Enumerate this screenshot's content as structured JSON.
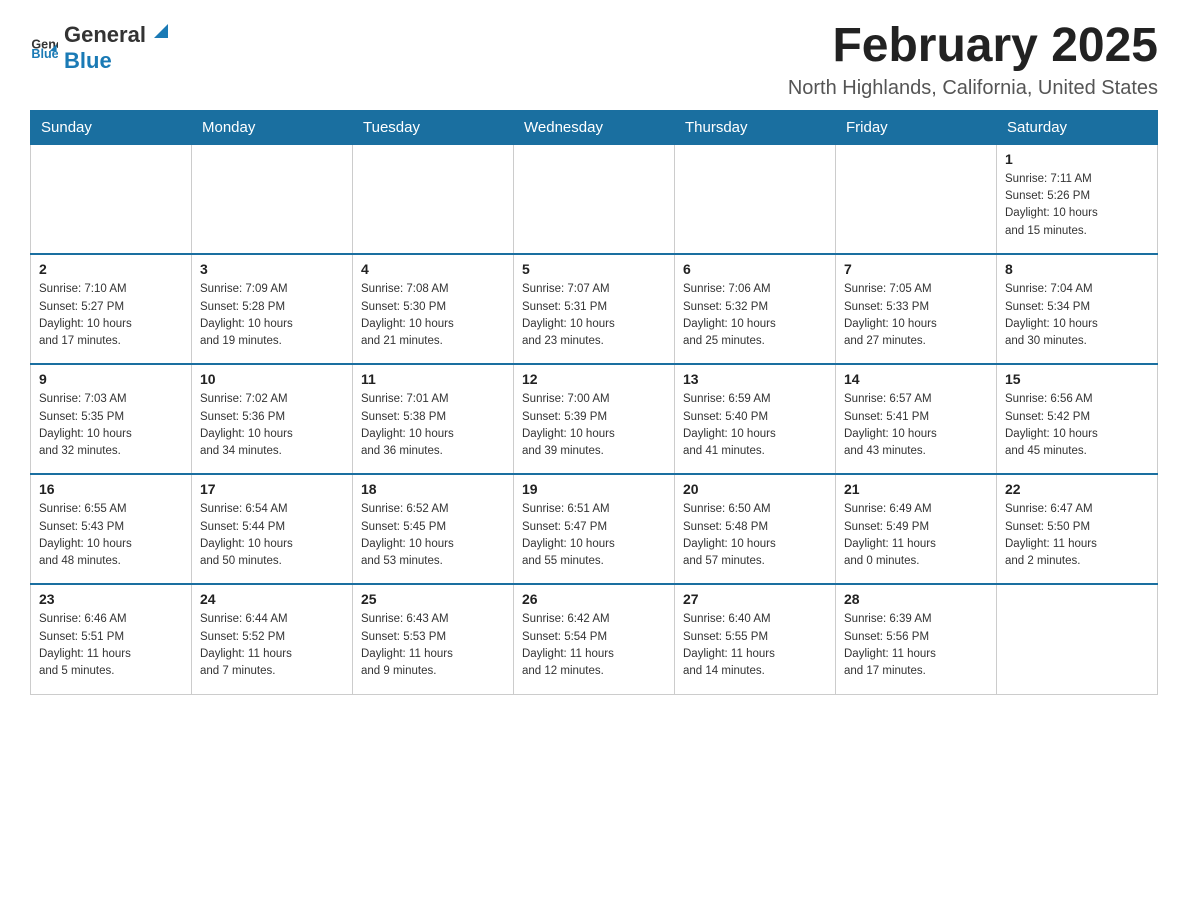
{
  "logo": {
    "text_general": "General",
    "text_blue": "Blue"
  },
  "title": "February 2025",
  "subtitle": "North Highlands, California, United States",
  "days_of_week": [
    "Sunday",
    "Monday",
    "Tuesday",
    "Wednesday",
    "Thursday",
    "Friday",
    "Saturday"
  ],
  "weeks": [
    [
      {
        "day": "",
        "info": ""
      },
      {
        "day": "",
        "info": ""
      },
      {
        "day": "",
        "info": ""
      },
      {
        "day": "",
        "info": ""
      },
      {
        "day": "",
        "info": ""
      },
      {
        "day": "",
        "info": ""
      },
      {
        "day": "1",
        "info": "Sunrise: 7:11 AM\nSunset: 5:26 PM\nDaylight: 10 hours\nand 15 minutes."
      }
    ],
    [
      {
        "day": "2",
        "info": "Sunrise: 7:10 AM\nSunset: 5:27 PM\nDaylight: 10 hours\nand 17 minutes."
      },
      {
        "day": "3",
        "info": "Sunrise: 7:09 AM\nSunset: 5:28 PM\nDaylight: 10 hours\nand 19 minutes."
      },
      {
        "day": "4",
        "info": "Sunrise: 7:08 AM\nSunset: 5:30 PM\nDaylight: 10 hours\nand 21 minutes."
      },
      {
        "day": "5",
        "info": "Sunrise: 7:07 AM\nSunset: 5:31 PM\nDaylight: 10 hours\nand 23 minutes."
      },
      {
        "day": "6",
        "info": "Sunrise: 7:06 AM\nSunset: 5:32 PM\nDaylight: 10 hours\nand 25 minutes."
      },
      {
        "day": "7",
        "info": "Sunrise: 7:05 AM\nSunset: 5:33 PM\nDaylight: 10 hours\nand 27 minutes."
      },
      {
        "day": "8",
        "info": "Sunrise: 7:04 AM\nSunset: 5:34 PM\nDaylight: 10 hours\nand 30 minutes."
      }
    ],
    [
      {
        "day": "9",
        "info": "Sunrise: 7:03 AM\nSunset: 5:35 PM\nDaylight: 10 hours\nand 32 minutes."
      },
      {
        "day": "10",
        "info": "Sunrise: 7:02 AM\nSunset: 5:36 PM\nDaylight: 10 hours\nand 34 minutes."
      },
      {
        "day": "11",
        "info": "Sunrise: 7:01 AM\nSunset: 5:38 PM\nDaylight: 10 hours\nand 36 minutes."
      },
      {
        "day": "12",
        "info": "Sunrise: 7:00 AM\nSunset: 5:39 PM\nDaylight: 10 hours\nand 39 minutes."
      },
      {
        "day": "13",
        "info": "Sunrise: 6:59 AM\nSunset: 5:40 PM\nDaylight: 10 hours\nand 41 minutes."
      },
      {
        "day": "14",
        "info": "Sunrise: 6:57 AM\nSunset: 5:41 PM\nDaylight: 10 hours\nand 43 minutes."
      },
      {
        "day": "15",
        "info": "Sunrise: 6:56 AM\nSunset: 5:42 PM\nDaylight: 10 hours\nand 45 minutes."
      }
    ],
    [
      {
        "day": "16",
        "info": "Sunrise: 6:55 AM\nSunset: 5:43 PM\nDaylight: 10 hours\nand 48 minutes."
      },
      {
        "day": "17",
        "info": "Sunrise: 6:54 AM\nSunset: 5:44 PM\nDaylight: 10 hours\nand 50 minutes."
      },
      {
        "day": "18",
        "info": "Sunrise: 6:52 AM\nSunset: 5:45 PM\nDaylight: 10 hours\nand 53 minutes."
      },
      {
        "day": "19",
        "info": "Sunrise: 6:51 AM\nSunset: 5:47 PM\nDaylight: 10 hours\nand 55 minutes."
      },
      {
        "day": "20",
        "info": "Sunrise: 6:50 AM\nSunset: 5:48 PM\nDaylight: 10 hours\nand 57 minutes."
      },
      {
        "day": "21",
        "info": "Sunrise: 6:49 AM\nSunset: 5:49 PM\nDaylight: 11 hours\nand 0 minutes."
      },
      {
        "day": "22",
        "info": "Sunrise: 6:47 AM\nSunset: 5:50 PM\nDaylight: 11 hours\nand 2 minutes."
      }
    ],
    [
      {
        "day": "23",
        "info": "Sunrise: 6:46 AM\nSunset: 5:51 PM\nDaylight: 11 hours\nand 5 minutes."
      },
      {
        "day": "24",
        "info": "Sunrise: 6:44 AM\nSunset: 5:52 PM\nDaylight: 11 hours\nand 7 minutes."
      },
      {
        "day": "25",
        "info": "Sunrise: 6:43 AM\nSunset: 5:53 PM\nDaylight: 11 hours\nand 9 minutes."
      },
      {
        "day": "26",
        "info": "Sunrise: 6:42 AM\nSunset: 5:54 PM\nDaylight: 11 hours\nand 12 minutes."
      },
      {
        "day": "27",
        "info": "Sunrise: 6:40 AM\nSunset: 5:55 PM\nDaylight: 11 hours\nand 14 minutes."
      },
      {
        "day": "28",
        "info": "Sunrise: 6:39 AM\nSunset: 5:56 PM\nDaylight: 11 hours\nand 17 minutes."
      },
      {
        "day": "",
        "info": ""
      }
    ]
  ]
}
